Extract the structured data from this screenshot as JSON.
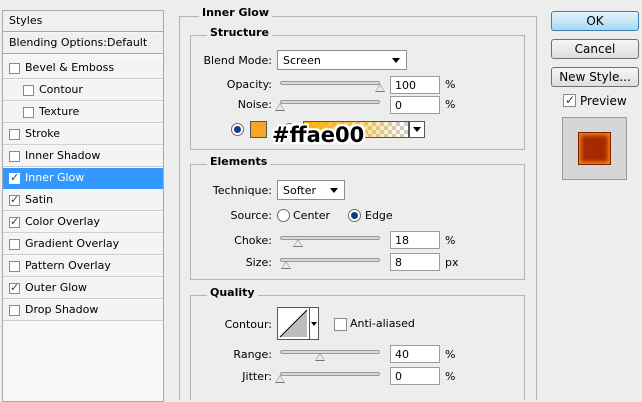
{
  "left_panel": {
    "header": "Styles",
    "blending": "Blending Options:Default",
    "items": [
      {
        "label": "Bevel & Emboss",
        "checked": false
      },
      {
        "label": "Contour",
        "checked": false
      },
      {
        "label": "Texture",
        "checked": false
      },
      {
        "label": "Stroke",
        "checked": false
      },
      {
        "label": "Inner Shadow",
        "checked": false
      },
      {
        "label": "Inner Glow",
        "checked": true,
        "selected": true
      },
      {
        "label": "Satin",
        "checked": true
      },
      {
        "label": "Color Overlay",
        "checked": true
      },
      {
        "label": "Gradient Overlay",
        "checked": false
      },
      {
        "label": "Pattern Overlay",
        "checked": false
      },
      {
        "label": "Outer Glow",
        "checked": true
      },
      {
        "label": "Drop Shadow",
        "checked": false
      }
    ]
  },
  "title": "Inner Glow",
  "structure": {
    "title": "Structure",
    "blend_mode_label": "Blend Mode:",
    "blend_mode_value": "Screen",
    "opacity_label": "Opacity:",
    "opacity_value": "100",
    "opacity_unit": "%",
    "opacity_level": 1.0,
    "noise_label": "Noise:",
    "noise_value": "0",
    "noise_unit": "%",
    "noise_level": 0.0,
    "color_swatch": "#f5a623",
    "gradient_from": "#ffae00",
    "annotation": "#ffae00"
  },
  "elements": {
    "title": "Elements",
    "technique_label": "Technique:",
    "technique_value": "Softer",
    "source_label": "Source:",
    "source_center": "Center",
    "source_edge": "Edge",
    "choke_label": "Choke:",
    "choke_value": "18",
    "choke_unit": "%",
    "choke_level": 0.18,
    "size_label": "Size:",
    "size_value": "8",
    "size_unit": "px",
    "size_level": 0.06
  },
  "quality": {
    "title": "Quality",
    "contour_label": "Contour:",
    "anti_aliased_label": "Anti-aliased",
    "anti_aliased": false,
    "range_label": "Range:",
    "range_value": "40",
    "range_unit": "%",
    "range_level": 0.4,
    "jitter_label": "Jitter:",
    "jitter_value": "0",
    "jitter_unit": "%",
    "jitter_level": 0.0
  },
  "buttons": {
    "ok": "OK",
    "cancel": "Cancel",
    "new_style": "New Style...",
    "preview_label": "Preview",
    "preview_checked": true
  },
  "colors": {
    "selection": "#3399ff",
    "preview_fill": "#a52a00",
    "preview_glow": "#ff8c00"
  }
}
